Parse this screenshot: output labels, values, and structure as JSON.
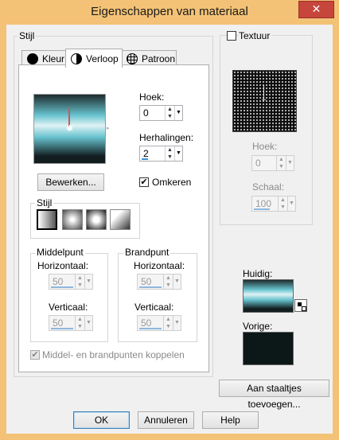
{
  "window": {
    "title": "Eigenschappen van materiaal",
    "close_glyph": "✕"
  },
  "stijl_group": {
    "label": "Stijl"
  },
  "tabs": [
    {
      "label": "Kleur",
      "icon": "black-circle-icon"
    },
    {
      "label": "Verloop",
      "icon": "half-circle-icon",
      "active": true
    },
    {
      "label": "Patroon",
      "icon": "grid-globe-icon"
    }
  ],
  "gradient": {
    "colors": [
      "#1e2b2d",
      "#68c3cf",
      "#dff2f4",
      "#68c3cf",
      "#121d1f"
    ]
  },
  "hoek": {
    "label": "Hoek:",
    "value": "0"
  },
  "herhalingen": {
    "label": "Herhalingen:",
    "value": "2"
  },
  "bewerken_button": "Bewerken...",
  "omkeren": {
    "label": "Omkeren",
    "checked": true
  },
  "stijl_sub": {
    "label": "Stijl"
  },
  "middelpunt": {
    "label": "Middelpunt",
    "horizontaal_label": "Horizontaal:",
    "horizontaal_value": "50",
    "verticaal_label": "Verticaal:",
    "verticaal_value": "50"
  },
  "brandpunt": {
    "label": "Brandpunt",
    "horizontaal_label": "Horizontaal:",
    "horizontaal_value": "50",
    "verticaal_label": "Verticaal:",
    "verticaal_value": "50"
  },
  "koppelen": {
    "label": "Middel- en brandpunten koppelen",
    "checked": true
  },
  "textuur": {
    "label": "Textuur",
    "checked": false,
    "hoek_label": "Hoek:",
    "hoek_value": "0",
    "schaal_label": "Schaal:",
    "schaal_value": "100"
  },
  "huidig": {
    "label": "Huidig:"
  },
  "vorige": {
    "label": "Vorige:"
  },
  "aan_staaltjes_button": "Aan staaltjes toevoegen...",
  "footer": {
    "ok": "OK",
    "annuleren": "Annuleren",
    "help": "Help"
  }
}
